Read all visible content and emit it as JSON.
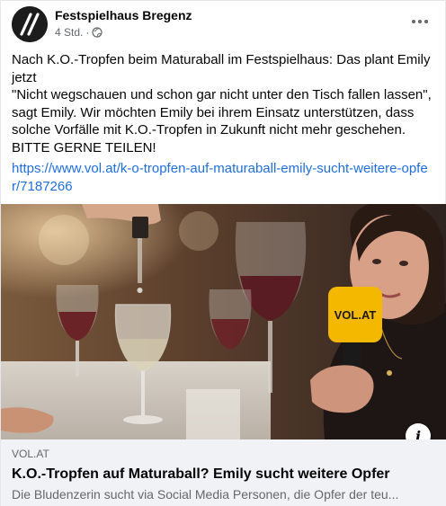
{
  "post": {
    "page_name": "Festspielhaus Bregenz",
    "time": "4 Std.",
    "separator": "·",
    "text_lines": [
      "Nach K.O.-Tropfen beim Maturaball im Festspielhaus: Das plant Emily jetzt",
      "\"Nicht wegschauen und schon gar nicht unter den Tisch fallen lassen\", sagt Emily. Wir möchten Emily bei ihrem Einsatz unterstützen, dass solche Vorfälle mit K.O.-Tropfen in Zukunft nicht mehr geschehen.",
      "BITTE GERNE TEILEN!"
    ],
    "link": "https://www.vol.at/k-o-tropfen-auf-maturaball-emily-sucht-weitere-opfer/7187266"
  },
  "media": {
    "mic_label": "VOL.AT"
  },
  "preview": {
    "domain": "VOL.AT",
    "title": "K.O.-Tropfen auf Maturaball? Emily sucht weitere Opfer",
    "description": "Die Bludenzerin sucht via Social Media Personen, die Opfer der teu..."
  },
  "icons": {
    "avatar": "slash-logo-icon",
    "privacy": "globe-icon",
    "more": "more-options-icon",
    "info": "info-icon"
  },
  "colors": {
    "link": "#216fdb",
    "preview_bg": "#f0f2f5",
    "mic_yellow": "#f5b800"
  }
}
